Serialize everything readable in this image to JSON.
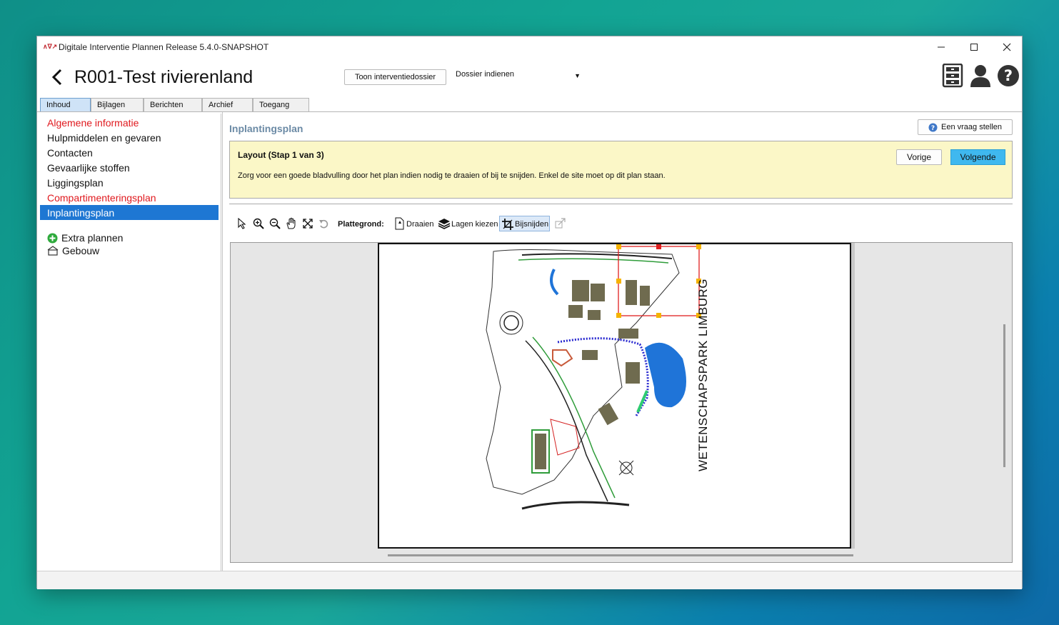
{
  "window": {
    "title": "Digitale Interventie Plannen Release 5.4.0-SNAPSHOT",
    "app_icon_text": "∧∇↗"
  },
  "header": {
    "title": "R001-Test rivierenland",
    "show_dossier_button": "Toon interventiedossier",
    "dossier_dropdown_value": "Dossier indienen"
  },
  "tabs": [
    "Inhoud",
    "Bijlagen",
    "Berichten",
    "Archief",
    "Toegang"
  ],
  "sidebar": {
    "items": [
      {
        "label": "Algemene informatie",
        "state": "red"
      },
      {
        "label": "Hulpmiddelen en gevaren",
        "state": "normal"
      },
      {
        "label": "Contacten",
        "state": "normal"
      },
      {
        "label": "Gevaarlijke stoffen",
        "state": "normal"
      },
      {
        "label": "Liggingsplan",
        "state": "normal"
      },
      {
        "label": "Compartimenteringsplan",
        "state": "red"
      },
      {
        "label": "Inplantingsplan",
        "state": "active"
      }
    ],
    "extra_plans": "Extra plannen",
    "building": "Gebouw"
  },
  "main": {
    "section_title": "Inplantingsplan",
    "ask_question_button": "Een vraag stellen",
    "info": {
      "title": "Layout (Stap 1 van 3)",
      "text": "Zorg voor een goede bladvulling door het plan indien nodig te draaien of bij te snijden. Enkel de site moet op dit plan staan.",
      "prev_button": "Vorige",
      "next_button": "Volgende"
    },
    "toolbar": {
      "plattegrond_label": "Plattegrond:",
      "rotate_label": "Draaien",
      "layers_label": "Lagen kiezen",
      "crop_label": "Bijsnijden"
    },
    "map_title": "WETENSCHAPSPARK LIMBURG"
  },
  "colors": {
    "accent_blue": "#1e77d3",
    "next_button": "#3fb8ef",
    "info_background": "#fbf7c7",
    "required_red": "#e0191e",
    "section_title": "#6b8aa5"
  }
}
